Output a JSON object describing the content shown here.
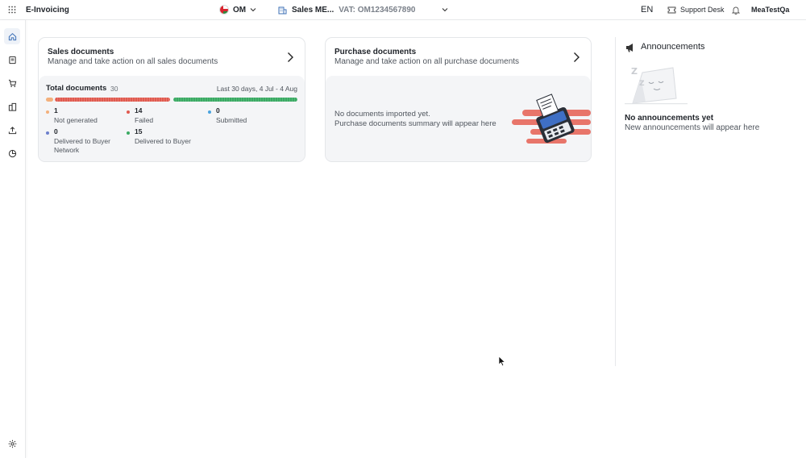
{
  "app": {
    "title": "E-Invoicing"
  },
  "header": {
    "country": "OM",
    "entity_name": "Sales ME...",
    "vat": "VAT: OM1234567890",
    "language": "EN",
    "support_label": "Support Desk",
    "user": "MeaTestQa"
  },
  "sidebar": {
    "items": [
      {
        "icon": "home-icon",
        "active": true
      },
      {
        "icon": "document-icon"
      },
      {
        "icon": "cart-icon"
      },
      {
        "icon": "building-icon"
      },
      {
        "icon": "upload-icon"
      },
      {
        "icon": "pie-chart-icon"
      }
    ],
    "footer_icon": "gear-icon"
  },
  "sales_card": {
    "title": "Sales documents",
    "subtitle": "Manage and take action on all sales documents",
    "total_label": "Total documents",
    "total_count": "30",
    "period": "Last 30 days, 4 Jul - 4 Aug",
    "stats": [
      {
        "value": "1",
        "label": "Not generated",
        "color": "#f3b07c"
      },
      {
        "value": "14",
        "label": "Failed",
        "color": "#e05a4f"
      },
      {
        "value": "0",
        "label": "Submitted",
        "color": "#4aa3df"
      },
      {
        "value": "0",
        "label": "Delivered to Buyer Network",
        "color": "#6d7fcc"
      },
      {
        "value": "15",
        "label": "Delivered to Buyer",
        "color": "#3aaa63"
      }
    ]
  },
  "purchase_card": {
    "title": "Purchase documents",
    "subtitle": "Manage and take action on all purchase documents",
    "empty_line1": "No documents imported yet.",
    "empty_line2": "Purchase documents summary will appear here"
  },
  "announcements": {
    "title": "Announcements",
    "empty_title": "No announcements yet",
    "empty_sub": "New announcements will appear here"
  }
}
